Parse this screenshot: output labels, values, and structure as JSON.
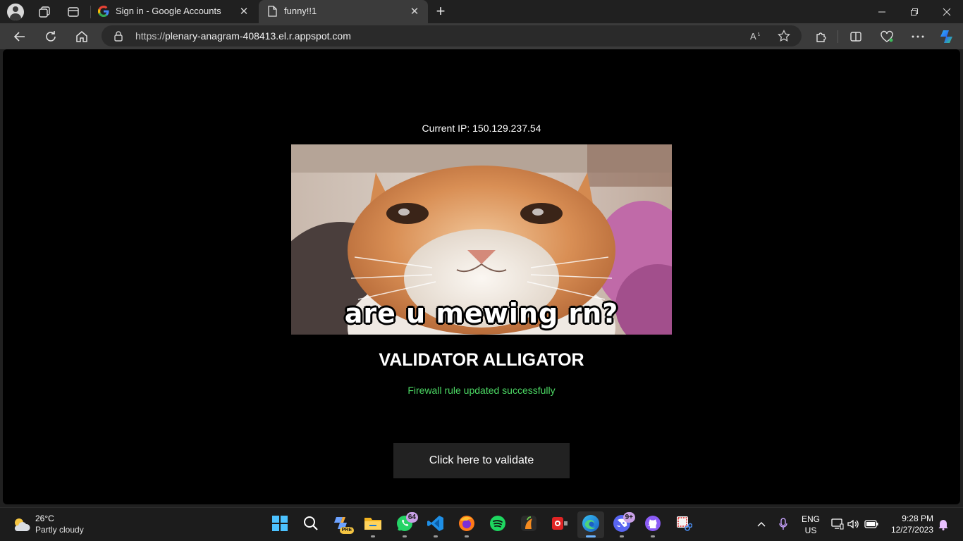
{
  "browser": {
    "tabs": [
      {
        "title": "Sign in - Google Accounts",
        "favicon": "google-g-icon",
        "active": false
      },
      {
        "title": "funny!!1",
        "favicon": "page-icon",
        "active": true
      }
    ],
    "address": {
      "scheme": "https://",
      "host": "plenary-anagram-408413.el.r.appspot.com"
    },
    "colors": {
      "chrome_dark": "#202020",
      "toolbar": "#3b3b3b",
      "accent": "#0a84ff"
    }
  },
  "page": {
    "ip_label": "Current IP: 150.129.237.54",
    "meme_caption": "are u mewing rn?",
    "heading": "VALIDATOR ALLIGATOR",
    "status_message": "Firewall rule updated successfully",
    "status_color": "#4cd964",
    "validate_button": "Click here to validate"
  },
  "taskbar": {
    "weather": {
      "temp": "26°C",
      "condition": "Partly cloudy",
      "icon": "partly-cloudy-icon"
    },
    "apps": [
      {
        "name": "start",
        "icon": "windows-logo-icon"
      },
      {
        "name": "search",
        "icon": "search-icon"
      },
      {
        "name": "copilot-pre",
        "icon": "copilot-icon",
        "badge": "PRE"
      },
      {
        "name": "file-explorer",
        "icon": "folder-icon"
      },
      {
        "name": "whatsapp",
        "icon": "whatsapp-icon",
        "badge": "64"
      },
      {
        "name": "vscode",
        "icon": "vscode-icon"
      },
      {
        "name": "firefox",
        "icon": "firefox-icon"
      },
      {
        "name": "spotify",
        "icon": "spotify-icon"
      },
      {
        "name": "fl-studio",
        "icon": "fruit-icon"
      },
      {
        "name": "screen-recorder",
        "icon": "record-icon"
      },
      {
        "name": "edge",
        "icon": "edge-icon",
        "active": true
      },
      {
        "name": "discord",
        "icon": "discord-icon",
        "badge": "9+"
      },
      {
        "name": "github",
        "icon": "github-icon"
      },
      {
        "name": "snipping-tool",
        "icon": "snip-icon"
      }
    ],
    "tray": {
      "lang_top": "ENG",
      "lang_bottom": "US",
      "time": "9:28 PM",
      "date": "12/27/2023"
    }
  }
}
